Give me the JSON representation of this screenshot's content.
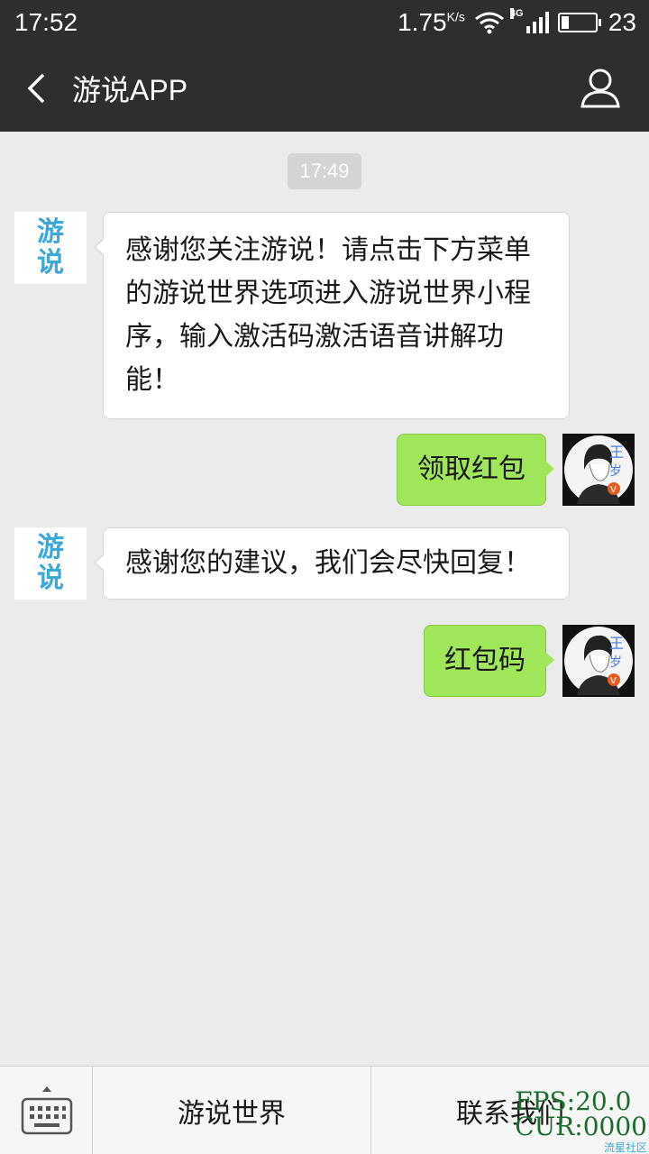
{
  "status_bar": {
    "time": "17:52",
    "speed": "1.75",
    "speed_unit": "K/s",
    "network": "3G",
    "battery": "23"
  },
  "header": {
    "title": "游说APP",
    "back_icon": "back-arrow-icon",
    "profile_icon": "person-icon"
  },
  "chat": {
    "timestamp": "17:49",
    "bot_avatar_text": [
      "游",
      "说"
    ],
    "messages": [
      {
        "side": "left",
        "text": "感谢您关注游说！请点击下方菜单的游说世界选项进入游说世界小程序，输入激活码激活语音讲解功能！"
      },
      {
        "side": "right",
        "text": "领取红包"
      },
      {
        "side": "left",
        "text": "感谢您的建议，我们会尽快回复！"
      },
      {
        "side": "right",
        "text": "红包码"
      }
    ]
  },
  "menu": {
    "keyboard_icon": "keyboard-icon",
    "items": [
      "游说世界",
      "联系我们"
    ]
  },
  "overlay": {
    "fps": "FPS:20.0",
    "cur": "CUR:0000",
    "watermark": "流星社区"
  },
  "colors": {
    "bar_bg": "#2e2e2e",
    "chat_bg": "#ebebeb",
    "bubble_green": "#9fe659",
    "logo_blue": "#3ba9d9"
  }
}
